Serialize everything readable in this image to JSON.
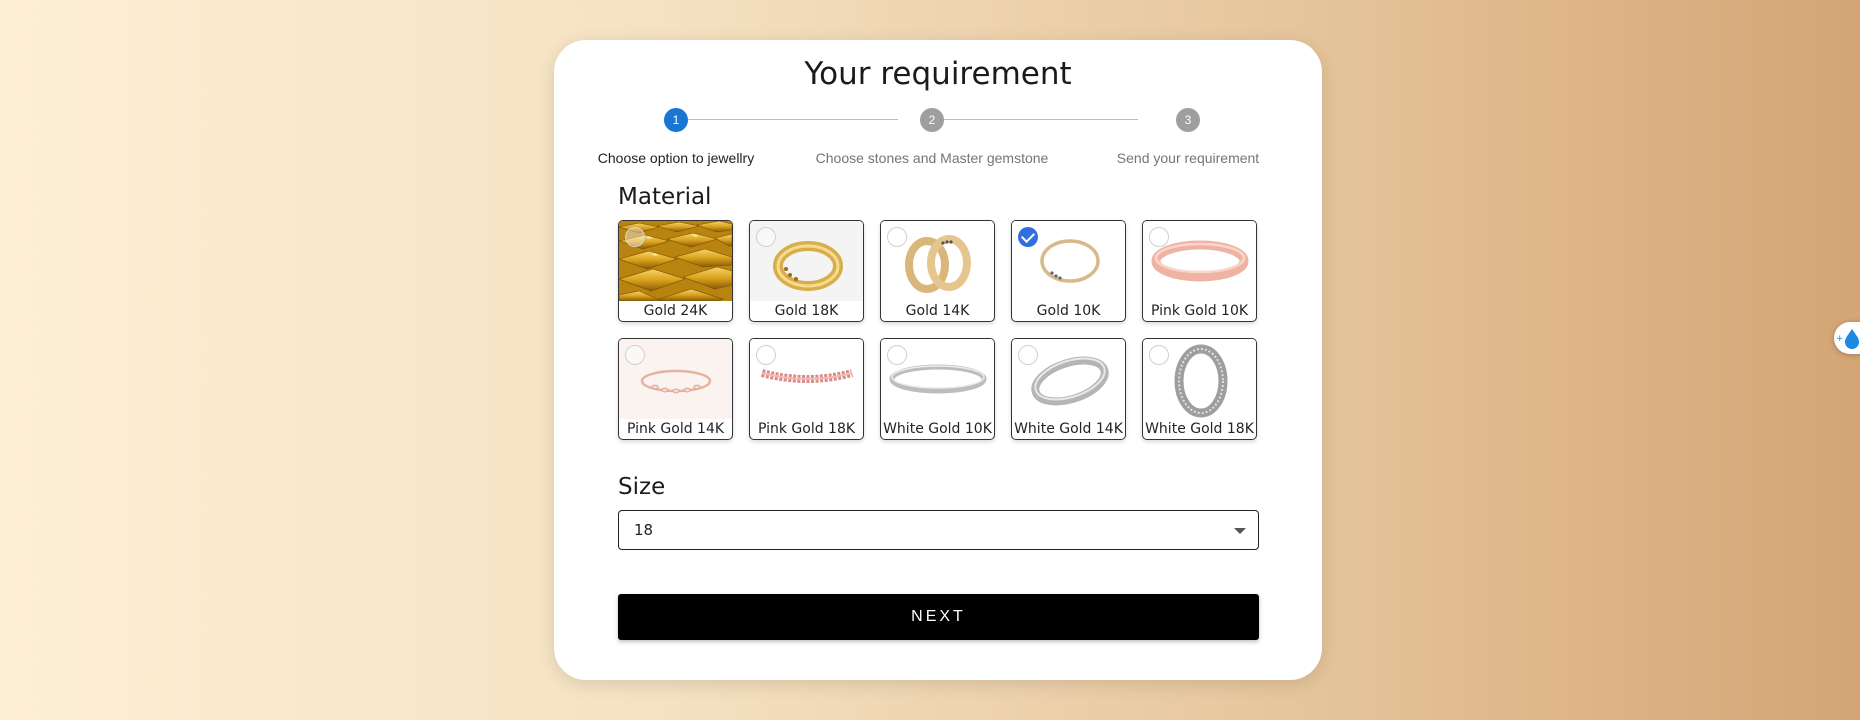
{
  "page": {
    "title": "Your requirement"
  },
  "stepper": {
    "steps": [
      {
        "number": "1",
        "label": "Choose option to jewellry",
        "active": true
      },
      {
        "number": "2",
        "label": "Choose stones and Master gemstone",
        "active": false
      },
      {
        "number": "3",
        "label": "Send your requirement",
        "active": false
      }
    ]
  },
  "material": {
    "label": "Material",
    "selected": "Gold 10K",
    "options": [
      {
        "label": "Gold 24K",
        "image": "gold-bars-image",
        "selected": false
      },
      {
        "label": "Gold 18K",
        "image": "yellow-gold-ring-image",
        "selected": false
      },
      {
        "label": "Gold 14K",
        "image": "yellow-gold-band-pair-image",
        "selected": false
      },
      {
        "label": "Gold 10K",
        "image": "thin-gold-ring-image",
        "selected": true
      },
      {
        "label": "Pink Gold 10K",
        "image": "rose-gold-band-image",
        "selected": false
      },
      {
        "label": "Pink Gold 14K",
        "image": "rose-gold-stone-band-image",
        "selected": false
      },
      {
        "label": "Pink Gold 18K",
        "image": "pink-gold-bracelet-image",
        "selected": false
      },
      {
        "label": "White Gold 10K",
        "image": "white-gold-thin-band-image",
        "selected": false
      },
      {
        "label": "White Gold 14K",
        "image": "white-gold-band-image",
        "selected": false
      },
      {
        "label": "White Gold 18K",
        "image": "white-gold-diamond-band-image",
        "selected": false
      }
    ]
  },
  "size": {
    "label": "Size",
    "value": "18"
  },
  "actions": {
    "next_label": "NEXT"
  },
  "colors": {
    "accent": "#1976d2",
    "check": "#2f6fde",
    "button": "#000000"
  },
  "side_widget": {
    "icon": "water-drop-icon"
  }
}
